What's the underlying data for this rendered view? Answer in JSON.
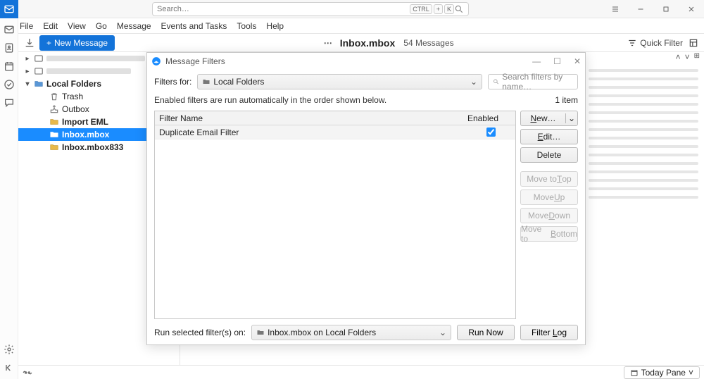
{
  "titlebar": {
    "search_placeholder": "Search…",
    "kbd1": "CTRL",
    "kbd_plus": "+",
    "kbd2": "K"
  },
  "menubar": [
    "File",
    "Edit",
    "View",
    "Go",
    "Message",
    "Events and Tasks",
    "Tools",
    "Help"
  ],
  "toolbar": {
    "new_message": "New Message",
    "folder_title": "Inbox.mbox",
    "message_count": "54 Messages",
    "quick_filter": "Quick Filter"
  },
  "folders": {
    "local_folders": "Local Folders",
    "trash": "Trash",
    "outbox": "Outbox",
    "import_eml": "Import EML",
    "inbox_mbox": "Inbox.mbox",
    "inbox_mbox833": "Inbox.mbox833"
  },
  "statusbar": {
    "today_pane": "Today Pane"
  },
  "dialog": {
    "title": "Message Filters",
    "filters_for_label": "Filters for:",
    "filters_for_value": "Local Folders",
    "search_placeholder": "Search filters by name…",
    "hint": "Enabled filters are run automatically in the order shown below.",
    "items_count": "1 item",
    "col_name": "Filter Name",
    "col_enabled": "Enabled",
    "filter_row_name": "Duplicate Email Filter",
    "filter_row_enabled": true,
    "buttons": {
      "new": "New…",
      "edit": "Edit…",
      "delete": "Delete",
      "move_top": "Move to Top",
      "move_up_prefix": "Move ",
      "move_up_u": "U",
      "move_up_suffix": "p",
      "move_down_prefix": "Move ",
      "move_down_u": "D",
      "move_down_suffix": "own",
      "move_bottom_prefix": "Move to ",
      "move_bottom_u": "B",
      "move_bottom_suffix": "ottom"
    },
    "run_label": "Run selected filter(s) on:",
    "run_target": "Inbox.mbox on Local Folders",
    "run_now": "Run Now",
    "filter_log": "Filter Log"
  }
}
